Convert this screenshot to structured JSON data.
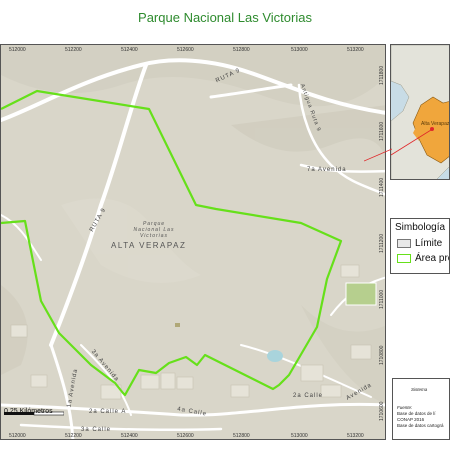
{
  "title": "Parque Nacional Las Victorias",
  "map": {
    "x_ticks": [
      "512000",
      "512200",
      "512400",
      "512600",
      "512800",
      "513000",
      "513200"
    ],
    "y_ticks": [
      "1711800",
      "1711600",
      "1711400",
      "1711200",
      "1711000",
      "1710800",
      "1710600"
    ],
    "place_labels": {
      "department": "ALTA VERAPAZ",
      "park": "Parque Nacional Las Victorias",
      "route9a": "RUTA 9",
      "route9b": "RUTA 9",
      "antigua": "Antigua Ruta 9",
      "avenida7": "7a Avenida",
      "avenida1": "1a Avenida",
      "avenida3": "3a Avenida",
      "calle4": "4a Calle",
      "calle2a": "2a Calle A",
      "calle2": "2a Calle",
      "calle3": "3a Calle",
      "avenida_r": "Avenida",
      "calle_b": "2a Calle"
    },
    "colors": {
      "terrain": "#d9d6c9",
      "boundary": "#66e01a",
      "roads": "#ffffff"
    }
  },
  "inset": {
    "label": "Alta Verapaz",
    "colors": {
      "region": "#f0a63c",
      "water": "#c8dce6",
      "land": "#e3e3da",
      "pointer": "#e0282a"
    }
  },
  "legend": {
    "title": "Simbología",
    "items": [
      {
        "label": "Límite",
        "color": "#e8e8e8"
      },
      {
        "label": "Área protegida",
        "color": "#ffffff"
      }
    ]
  },
  "scale": {
    "label": "0.25 Kilómetros"
  },
  "info": {
    "heading": "Sistema",
    "source_label": "Fuente:",
    "lines": [
      "Base de datos de lí",
      "CONAP 2016",
      "Base de datos cartográ"
    ]
  }
}
